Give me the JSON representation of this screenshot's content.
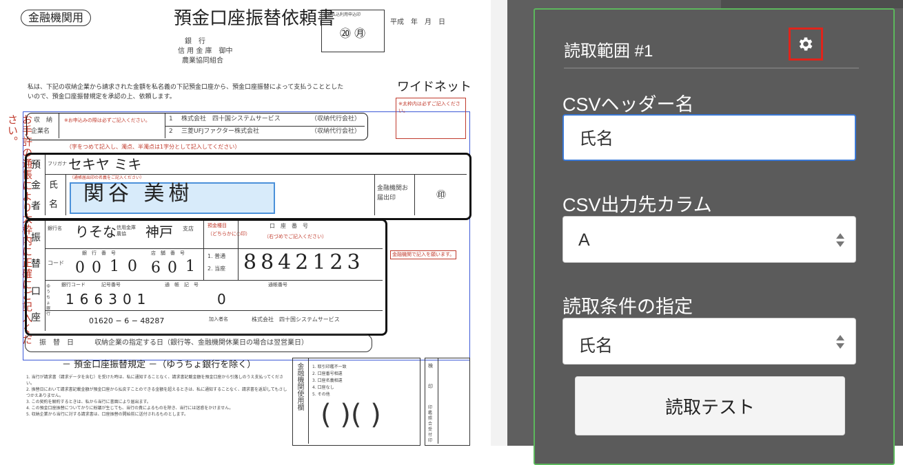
{
  "form": {
    "institution_tag": "金融機関用",
    "title": "預金口座振替依頼書",
    "stamp_label": "自動払込利用申込印",
    "stamp_marks": "⑳ ㊊",
    "date_label": "平成　年　月　日",
    "addressee_lines": [
      "銀　行",
      "信 用 金 庫　御中",
      "農業協同組合"
    ],
    "intro": "私は、下記の収納企業から請求された金額を私名義の下記預金口座から、預金口座振替によって支払うこととしたいので、預金口座振替規定を承認の上、依頼します。",
    "brand": "ワイドネット",
    "side_note": "お手許の通帳により太枠内に正確にご記入ください。",
    "collector": {
      "label1": "収　納",
      "label2": "企業名",
      "note": "※お申込みの際は必ずご記入ください。",
      "row1_no": "1",
      "row1_name": "株式会社　四十国システムサービス",
      "row1_tag": "（収納代行会社）",
      "row2_no": "2",
      "row2_name": "三菱UFJファクター株式会社",
      "row2_tag": "（収納代行会社）"
    },
    "right_note": "※太枠内は必ずご記入ください。",
    "instruction_red": "（字をつめて記入し、濁点、半濁点は1字分として記入してください）",
    "holder": {
      "label": [
        "預",
        "金",
        "者"
      ],
      "kana_label": "フリガナ",
      "kana_value": "セキヤ ミキ",
      "name_label_1": "氏",
      "name_label_2": "名",
      "name_hint": "（通帳届出印の名義をご記入ください）",
      "name_value": "関谷 美樹",
      "seal_label": "金融機関お届出印",
      "seal_mark": "㊞"
    },
    "account": {
      "label": [
        "振",
        "替",
        "口",
        "座"
      ],
      "bank_label": "銀行名",
      "bank_value": "りそな",
      "bank_types": "信用金庫 農協",
      "branch_value": "神戸",
      "branch_label": "支店",
      "type_title": "預金種目",
      "type_note": "（どちらかに○印）",
      "type_1": "1. 普通",
      "type_2": "2. 当座",
      "number_label": "口　座　番　号",
      "number_note": "（右づめでご記入ください）",
      "code_label": "コード",
      "bank_code_label": "銀　行　番　号",
      "bank_code": [
        "0",
        "0",
        "1",
        "0"
      ],
      "branch_code_label": "店　舗　番　号",
      "branch_code": [
        "6",
        "0",
        "1"
      ],
      "account_number": "8842123",
      "right_hint": "金融機関で記入を願います。"
    },
    "yucho": {
      "side_label": "ゆうちょ銀行",
      "code_label": "銀行コード",
      "symbol_label": "記号番号",
      "number_label": "通　帳　記　号",
      "digits": [
        "1",
        "6",
        "6",
        "3",
        "0",
        "1"
      ],
      "tail": "0",
      "account_label": "通帳番号",
      "account_value": "01620 − 6 − 48287",
      "holder_label": "加入者名",
      "holder_value": "株式会社　四十国システムサービス"
    },
    "transfer_day_label": "振　替　日",
    "transfer_day_value": "収納企業の指定する日（銀行等、金融機関休業日の場合は翌営業日）",
    "rules_title": "－ 預金口座振替規定 －（ゆうちょ銀行を除く）",
    "rules_text": [
      "1. 当行が請求書（請求データを含む）を受けた時は、私に通知することなく、請求書記載金額を預金口座から引落しのうえ支払ってください。",
      "2. 振替日において請求書記載金額が預金口座から払戻すことのできる金額を超えるときは、私に通知することなく、請求書を返却してもさしつかえありません。",
      "3. この契約を解約するときは、私から当行に書面により届出ます。",
      "4. この預金口座振替についてかりに紛議が生じても、当行の責によるものを除き、当行には迷惑をかけません。",
      "5. 収納企業から当行に対する請求書は、口座振替の開始前に送付されるものとします。"
    ],
    "bank_use_title": "金融機関使用欄",
    "bank_use_items": [
      "1. 取引印鑑不一致",
      "2. 口座番号相違",
      "3. 口座名義相違",
      "4. 口座なし",
      "5. その他"
    ],
    "bank_use_cols": [
      "検",
      "印",
      "印鑑照合",
      "受付印"
    ]
  },
  "panel": {
    "range_title": "読取範囲 #1",
    "csv_header_label": "CSVヘッダー名",
    "csv_header_value": "氏名",
    "csv_column_label": "CSV出力先カラム",
    "csv_column_value": "A",
    "condition_label": "読取条件の指定",
    "condition_value": "氏名",
    "test_button": "読取テスト"
  }
}
